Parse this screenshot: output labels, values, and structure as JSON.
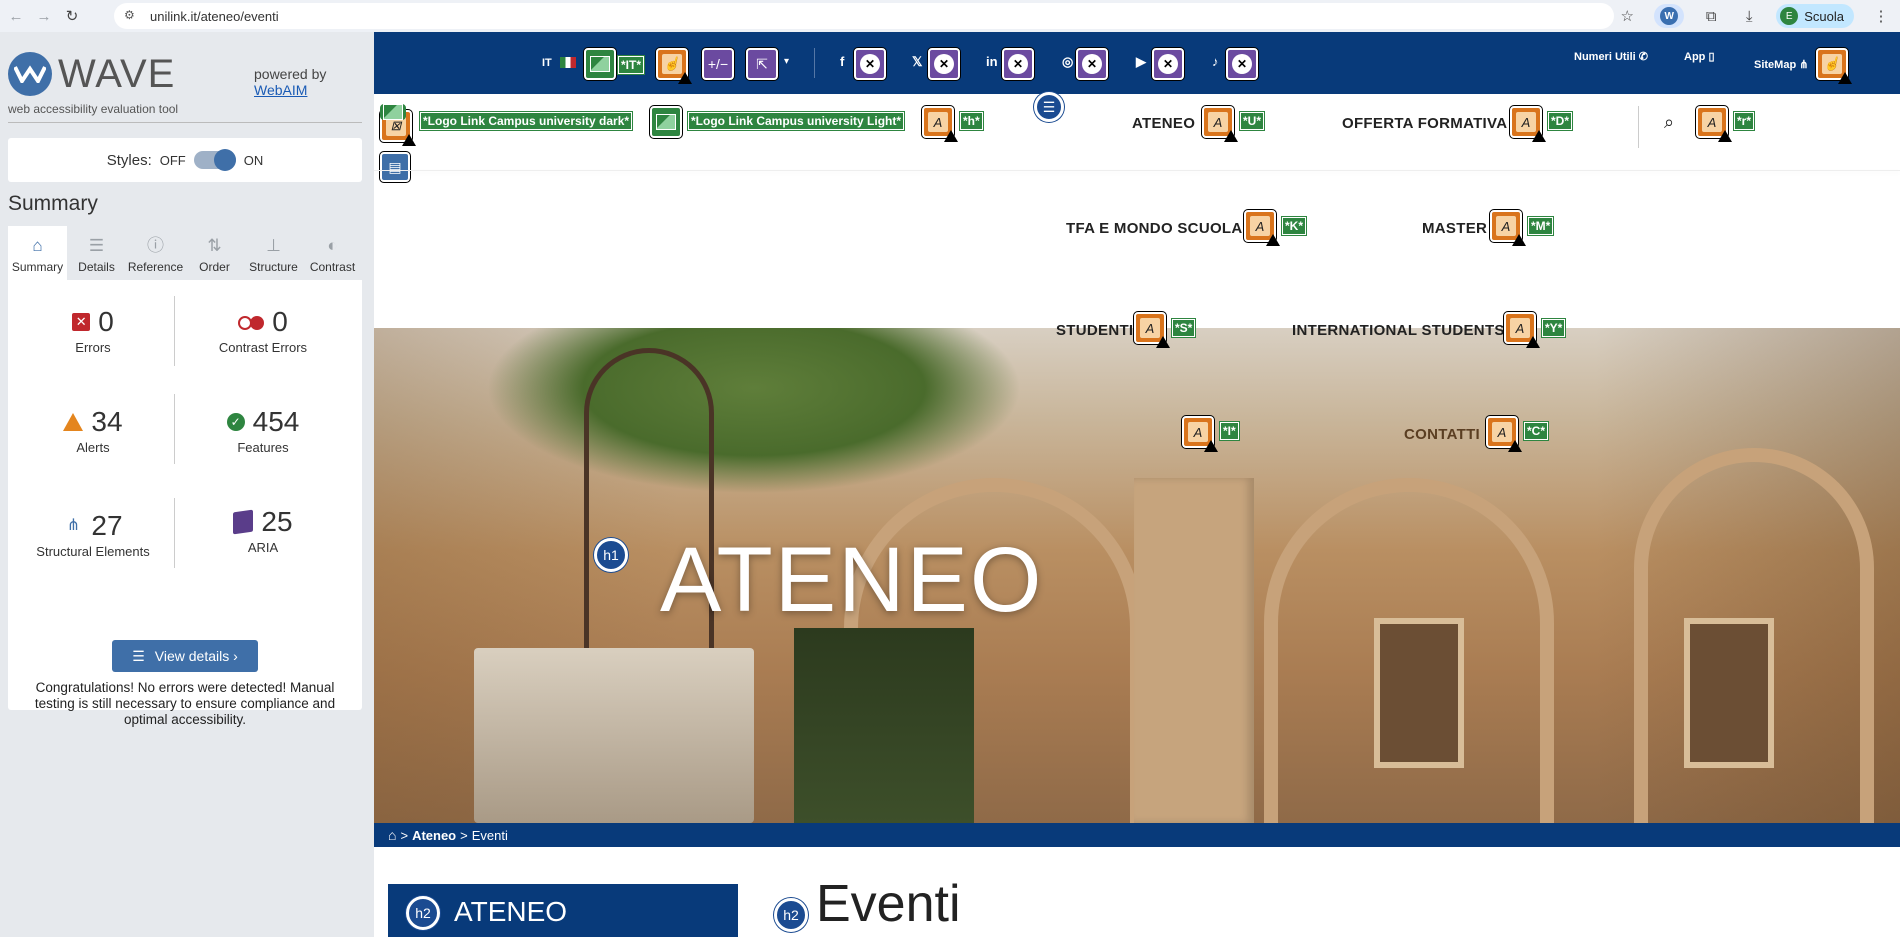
{
  "browser": {
    "url": "unilink.it/ateneo/eventi",
    "profile_name": "Scuola",
    "profile_initial": "E"
  },
  "wave": {
    "title": "WAVE",
    "subtitle": "web accessibility evaluation tool",
    "powered_by": "powered by",
    "webaim": "WebAIM",
    "styles_label": "Styles:",
    "off": "OFF",
    "on": "ON",
    "summary_heading": "Summary",
    "tabs": [
      {
        "label": "Summary",
        "icon": "home-icon"
      },
      {
        "label": "Details",
        "icon": "list-icon"
      },
      {
        "label": "Reference",
        "icon": "info-icon"
      },
      {
        "label": "Order",
        "icon": "order-icon"
      },
      {
        "label": "Structure",
        "icon": "structure-icon"
      },
      {
        "label": "Contrast",
        "icon": "contrast-icon"
      }
    ],
    "stats": {
      "errors": {
        "value": "0",
        "label": "Errors"
      },
      "contrast": {
        "value": "0",
        "label": "Contrast Errors"
      },
      "alerts": {
        "value": "34",
        "label": "Alerts"
      },
      "features": {
        "value": "454",
        "label": "Features"
      },
      "structural": {
        "value": "27",
        "label": "Structural Elements"
      },
      "aria": {
        "value": "25",
        "label": "ARIA"
      }
    },
    "view_details": "View details ›",
    "congrats": "Congratulations! No errors were detected! Manual testing is still necessary to ensure compliance and optimal accessibility."
  },
  "site": {
    "lang": "IT",
    "lang_label": "*IT*",
    "numeri_utili": "Numeri Utili",
    "app": "App",
    "sitemap": "SiteMap",
    "logo_dark": "*Logo Link Campus university dark*",
    "logo_light": "*Logo Link Campus university Light*",
    "label_h": "*h*",
    "label_U": "*U*",
    "label_D": "*D*",
    "label_r": "*r*",
    "label_K": "*K*",
    "label_M": "*M*",
    "label_S": "*S*",
    "label_Y": "*Y*",
    "label_I": "*I*",
    "label_C": "*C*",
    "nav": {
      "ateneo": "ATENEO",
      "offerta": "OFFERTA FORMATIVA",
      "tfa": "TFA E MONDO SCUOLA",
      "master": "MASTER",
      "studenti": "STUDENTI",
      "international": "INTERNATIONAL STUDENTS",
      "contatti": "CONTATTI"
    },
    "socials": [
      "f",
      "𝕏",
      "in",
      "◎",
      "▶",
      "♪"
    ],
    "hero_title": "ATENEO",
    "h1": "h1",
    "h2": "h2",
    "breadcrumb": {
      "ateneo": "Ateneo",
      "current": "Eventi"
    },
    "sidebar_title": "ATENEO",
    "page_title": "Eventi"
  }
}
